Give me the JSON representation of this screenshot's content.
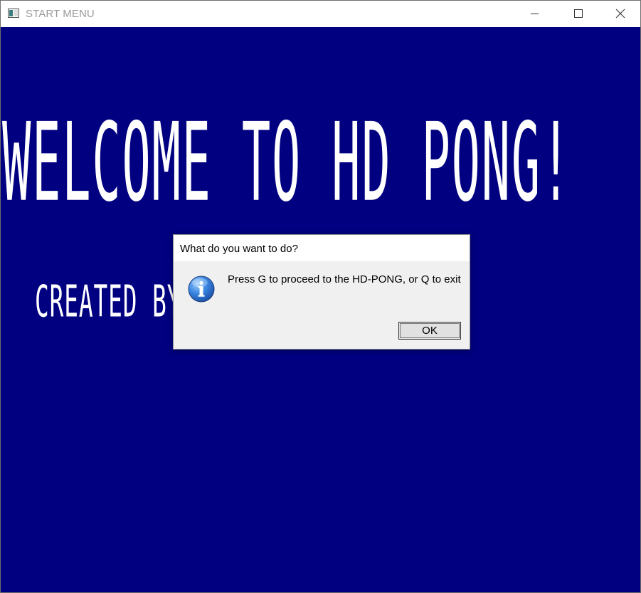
{
  "window": {
    "title": "START MENU",
    "controls": {
      "minimize_icon": "minimize-icon",
      "maximize_icon": "maximize-icon",
      "close_icon": "close-icon"
    }
  },
  "game": {
    "headline": "WELCOME TO HD PONG!",
    "credit": "CREATED BY ADAM BELTHUR",
    "background_color": "#000080",
    "text_color": "#ffffff"
  },
  "dialog": {
    "title": "What do you want to do?",
    "icon": "info-icon",
    "message": "Press G to proceed to the HD-PONG, or Q to exit",
    "ok_label": "OK"
  }
}
